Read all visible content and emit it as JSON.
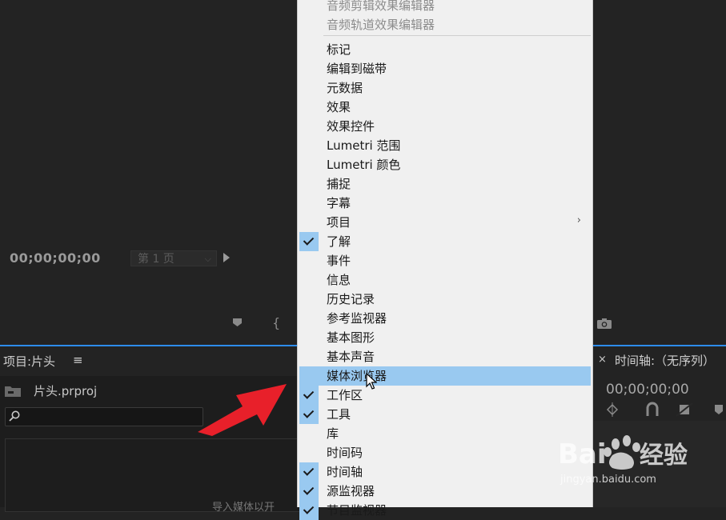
{
  "upper": {
    "timecode": "00;00;00;00",
    "page_select": "第 1 页"
  },
  "project_panel": {
    "title": "项目:片头",
    "menu_icon": "≡",
    "file_name": "片头.prproj",
    "search_placeholder": "",
    "hint": "导入媒体以开"
  },
  "timeline_panel": {
    "close": "×",
    "title": "时间轴:（无序列）",
    "timecode": "00;00;00;00"
  },
  "menu": {
    "items": [
      {
        "label": "音频剪辑效果编辑器",
        "checked": false,
        "disabled": true
      },
      {
        "label": "音频轨道效果编辑器",
        "checked": false,
        "disabled": true
      },
      {
        "label": "标记",
        "checked": false
      },
      {
        "label": "编辑到磁带",
        "checked": false
      },
      {
        "label": "元数据",
        "checked": false
      },
      {
        "label": "效果",
        "checked": false
      },
      {
        "label": "效果控件",
        "checked": false
      },
      {
        "label": "Lumetri 范围",
        "checked": false
      },
      {
        "label": "Lumetri 颜色",
        "checked": false
      },
      {
        "label": "捕捉",
        "checked": false
      },
      {
        "label": "字幕",
        "checked": false
      },
      {
        "label": "项目",
        "checked": false,
        "submenu": "›"
      },
      {
        "label": "了解",
        "checked": true
      },
      {
        "label": "事件",
        "checked": false
      },
      {
        "label": "信息",
        "checked": false
      },
      {
        "label": "历史记录",
        "checked": false
      },
      {
        "label": "参考监视器",
        "checked": false
      },
      {
        "label": "基本图形",
        "checked": false
      },
      {
        "label": "基本声音",
        "checked": false
      },
      {
        "label": "媒体浏览器",
        "checked": false,
        "highlighted": true
      },
      {
        "label": "工作区",
        "checked": true
      },
      {
        "label": "工具",
        "checked": true
      },
      {
        "label": "库",
        "checked": false
      },
      {
        "label": "时间码",
        "checked": false
      },
      {
        "label": "时间轴",
        "checked": true
      },
      {
        "label": "源监视器",
        "checked": true
      },
      {
        "label": "节目监视器",
        "checked": true
      }
    ]
  },
  "watermark": {
    "text": "jingyan.baidu.com"
  },
  "colors": {
    "accent_blue": "#2d8ceb",
    "menu_highlight": "#99c9f0",
    "arrow_red": "#e8202a"
  }
}
